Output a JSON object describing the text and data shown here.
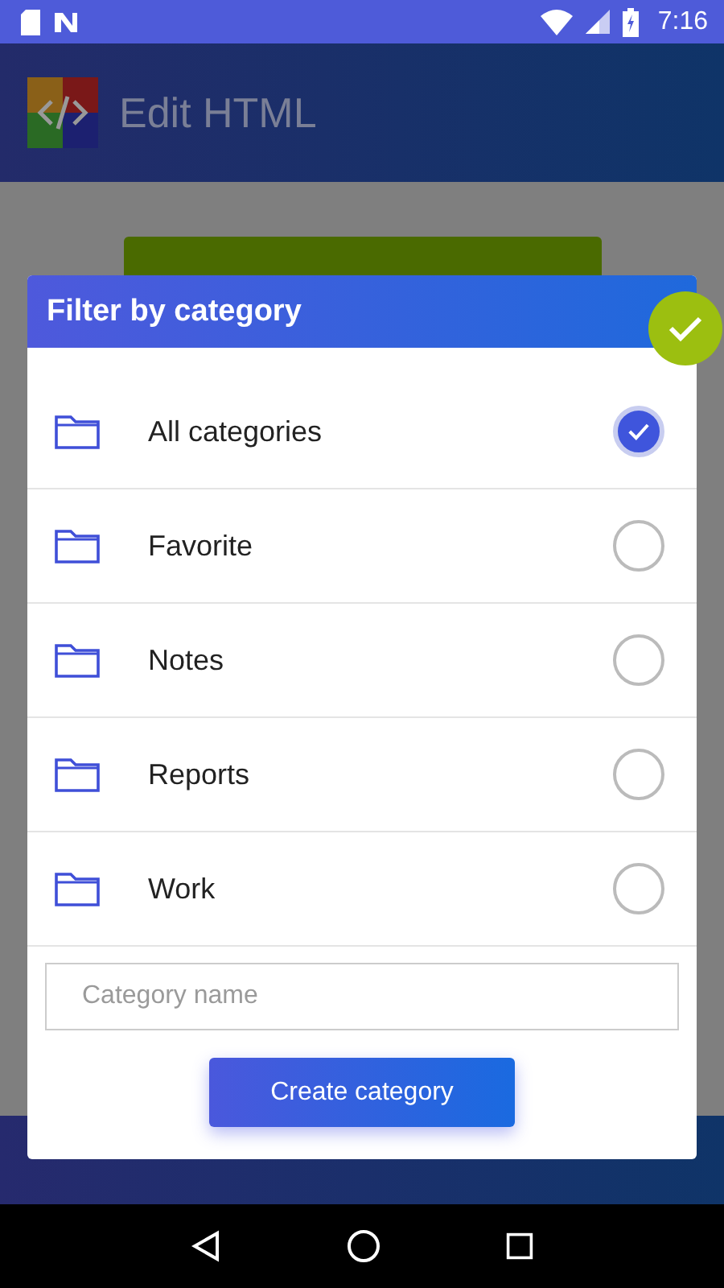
{
  "status_bar": {
    "time": "7:16"
  },
  "app_bar": {
    "title": "Edit HTML"
  },
  "dialog": {
    "title": "Filter by category",
    "categories": [
      {
        "label": "All categories",
        "selected": true
      },
      {
        "label": "Favorite",
        "selected": false
      },
      {
        "label": "Notes",
        "selected": false
      },
      {
        "label": "Reports",
        "selected": false
      },
      {
        "label": "Work",
        "selected": false
      }
    ],
    "input": {
      "placeholder": "Category name"
    },
    "button": "Create category"
  }
}
